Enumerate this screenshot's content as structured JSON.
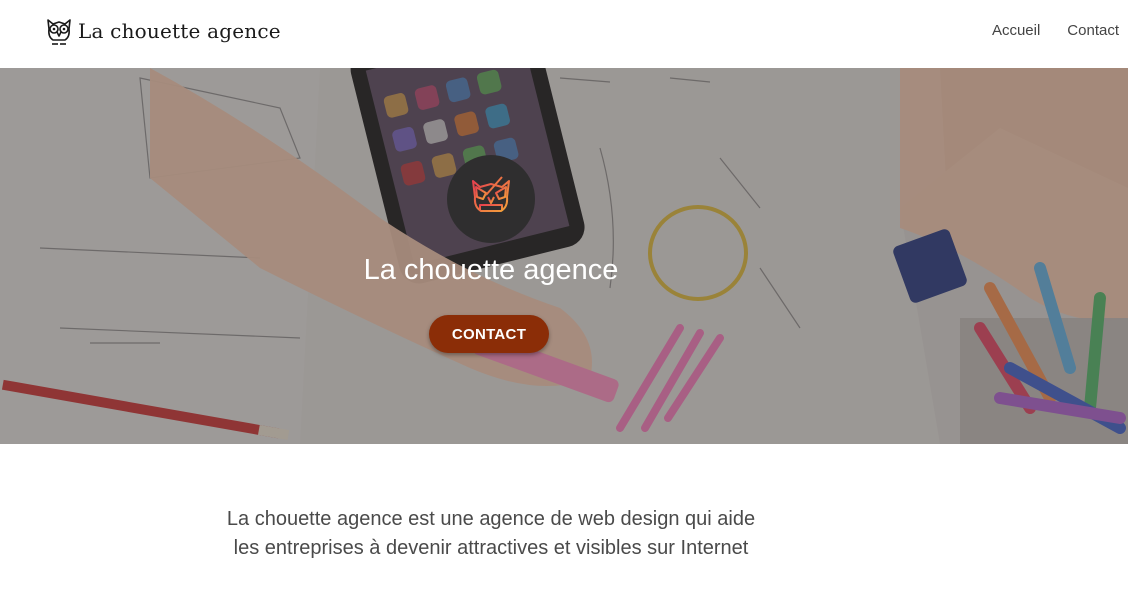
{
  "header": {
    "brand_name": "La chouette agence",
    "logo_icon": "owl-icon"
  },
  "nav": {
    "items": [
      {
        "label": "Accueil"
      },
      {
        "label": "Contact"
      }
    ]
  },
  "hero": {
    "logo_icon": "owl-icon",
    "title": "La chouette agence",
    "cta_label": "CONTACT",
    "cta_color": "#8b2d07"
  },
  "intro": {
    "line1": "La chouette agence est une agence de web design qui aide",
    "line2": "les entreprises à devenir attractives et visibles sur Internet"
  }
}
